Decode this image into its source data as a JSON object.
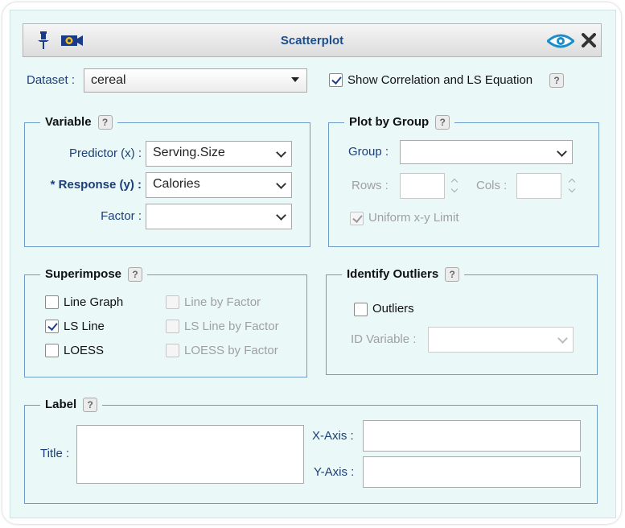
{
  "window": {
    "title": "Scatterplot",
    "icons": [
      "pin-icon",
      "camera-icon",
      "eye-icon",
      "close-icon"
    ]
  },
  "dataset": {
    "label": "Dataset :",
    "value": "cereal",
    "show_corr_label": "Show Correlation and LS Equation",
    "show_corr_checked": true
  },
  "variable": {
    "legend": "Variable",
    "predictor_label": "Predictor (x) :",
    "predictor_value": "Serving.Size",
    "response_label": "* Response (y) :",
    "response_value": "Calories",
    "factor_label": "Factor :",
    "factor_value": ""
  },
  "plot_by_group": {
    "legend": "Plot by Group",
    "group_label": "Group :",
    "group_value": "",
    "rows_label": "Rows :",
    "cols_label": "Cols :",
    "uniform_label": "Uniform x-y Limit",
    "uniform_checked": true
  },
  "superimpose": {
    "legend": "Superimpose",
    "line_graph": "Line Graph",
    "ls_line": "LS Line",
    "loess": "LOESS",
    "line_by_factor": "Line by Factor",
    "ls_line_by_factor": "LS Line by Factor",
    "loess_by_factor": "LOESS by Factor",
    "ls_line_checked": true
  },
  "identify_outliers": {
    "legend": "Identify Outliers",
    "outliers_label": "Outliers",
    "id_variable_label": "ID Variable :",
    "id_variable_value": ""
  },
  "label": {
    "legend": "Label",
    "title_label": "Title :",
    "xaxis_label": "X-Axis :",
    "yaxis_label": "Y-Axis :"
  },
  "help_glyph": "?",
  "colors": {
    "panel_bg": "#eaf8f8",
    "label_text": "#1c3f78",
    "border": "#6e9bc8"
  }
}
